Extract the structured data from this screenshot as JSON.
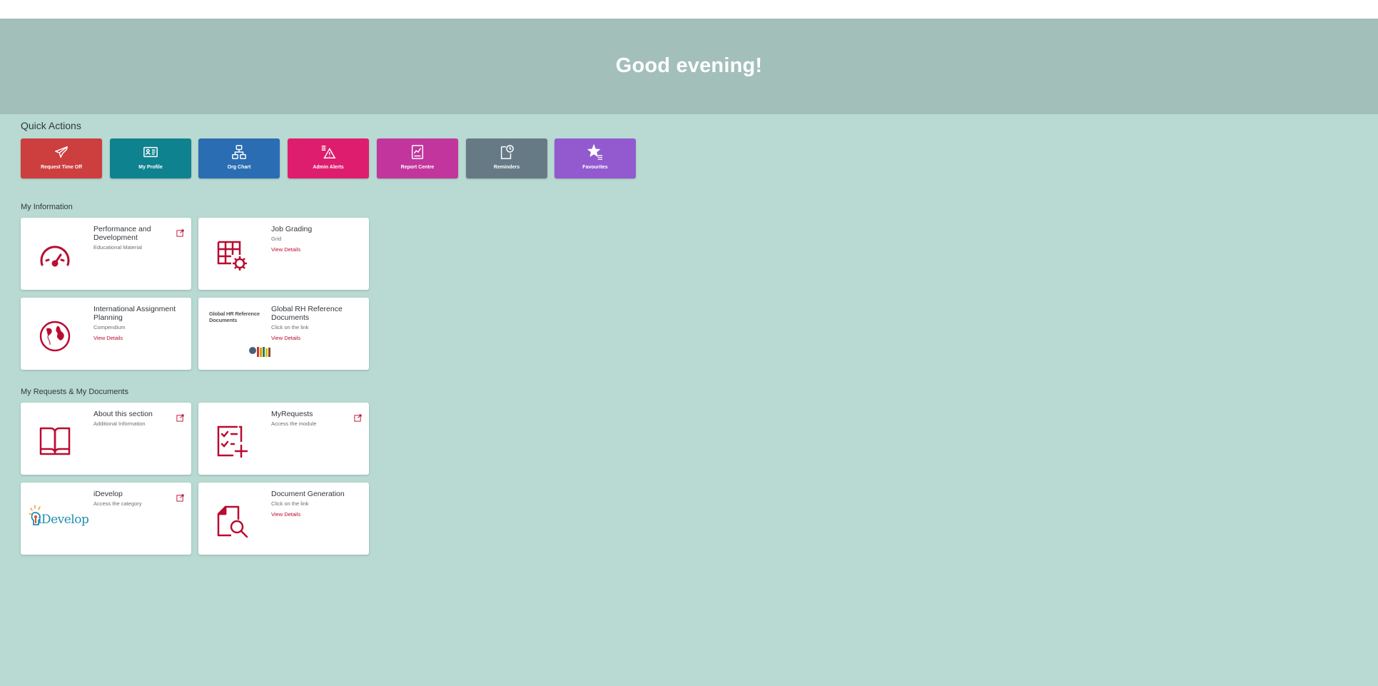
{
  "hero": {
    "title": "Good evening!"
  },
  "quick_actions": {
    "label": "Quick Actions",
    "tiles": [
      {
        "label": "Request Time Off",
        "icon": "airplane-icon",
        "color": "#cd3e3e"
      },
      {
        "label": "My Profile",
        "icon": "id-card-icon",
        "color": "#0f828f"
      },
      {
        "label": "Org Chart",
        "icon": "org-chart-icon",
        "color": "#2b6db3"
      },
      {
        "label": "Admin Alerts",
        "icon": "alert-icon",
        "color": "#df1d6e"
      },
      {
        "label": "Report Centre",
        "icon": "report-icon",
        "color": "#c2359d"
      },
      {
        "label": "Reminders",
        "icon": "reminder-icon",
        "color": "#667a86"
      },
      {
        "label": "Favourites",
        "icon": "star-icon",
        "color": "#925ace"
      }
    ]
  },
  "my_information": {
    "label": "My Information",
    "cards": [
      {
        "title": "Performance and Development",
        "subtitle": "Educational Material",
        "link": "",
        "icon": "speedometer-icon"
      },
      {
        "title": "Job Grading",
        "subtitle": "Grid",
        "link": "View Details",
        "icon": "grid-gear-icon"
      },
      {
        "title": "International Assignment Planning",
        "subtitle": "Compendium",
        "link": "View Details",
        "icon": "globe-icon"
      },
      {
        "title": "Global RH Reference Documents",
        "subtitle": "Click on the link",
        "link": "View Details",
        "icon": "global-hr-logo",
        "logo_text": "Global HR Reference Documents"
      }
    ]
  },
  "my_requests": {
    "label": "My Requests & My Documents",
    "cards": [
      {
        "title": "About this section",
        "subtitle": "Additional Information",
        "link": "",
        "icon": "open-book-icon"
      },
      {
        "title": "MyRequests",
        "subtitle": "Access the module",
        "link": "",
        "icon": "checklist-add-icon"
      },
      {
        "title": "iDevelop",
        "subtitle": "Access the category",
        "link": "",
        "icon": "idevelop-logo",
        "logo_text": "iDevelop"
      },
      {
        "title": "Document Generation",
        "subtitle": "Click on the link",
        "link": "View Details",
        "icon": "document-search-icon"
      }
    ]
  },
  "colors": {
    "accent": "#bb0a30",
    "background": "#b8dad2",
    "hero": "#a3bfb9"
  }
}
